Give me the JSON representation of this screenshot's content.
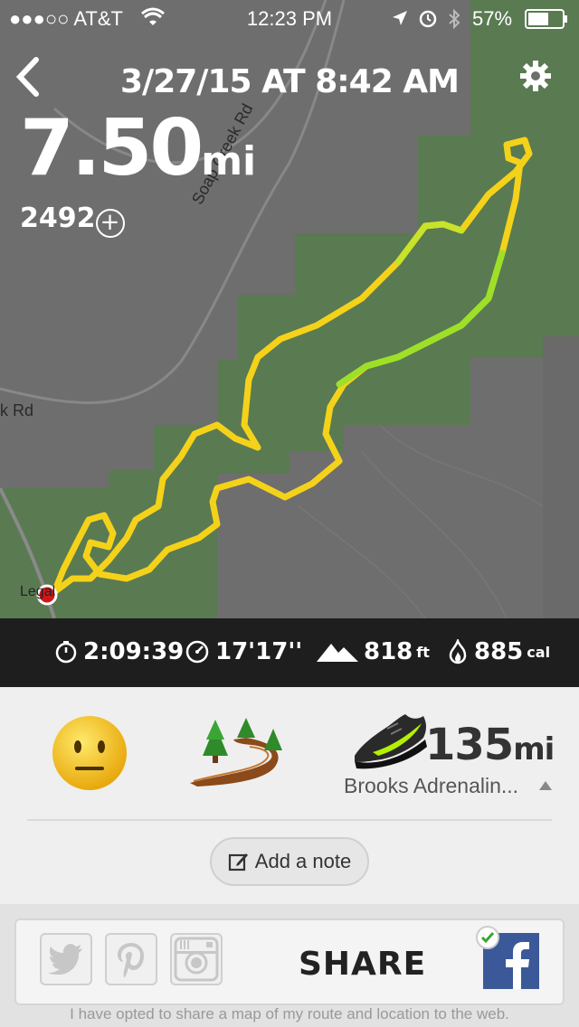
{
  "status_bar": {
    "carrier": "●●●○○ AT&T",
    "time": "12:23 PM",
    "battery": "57%"
  },
  "header": {
    "title": "3/27/15 AT 8:42 AM"
  },
  "run": {
    "distance_value": "7.50",
    "distance_unit": "mi",
    "fuel": "2492"
  },
  "map": {
    "road_labels": [
      "Soap Creek Rd",
      "k Rd"
    ],
    "legal": "Legal"
  },
  "stats": {
    "duration": "2:09:39",
    "pace": "17'17''",
    "elevation_value": "818",
    "elevation_unit": "ft",
    "calories_value": "885",
    "calories_unit": "cal"
  },
  "details": {
    "shoe_distance_value": "135",
    "shoe_distance_unit": "mi",
    "shoe_name": "Brooks Adrenalin...",
    "add_note_label": "Add a note"
  },
  "share": {
    "label": "SHARE",
    "disclaimer": "I have opted to share a map of my route and location to the web."
  },
  "icons": {
    "mood": "neutral-face-icon",
    "terrain": "trail-icon",
    "shoe": "shoe-icon"
  },
  "colors": {
    "map_green": "#5a7a52",
    "map_gray": "#6e6e6e",
    "route_yellow": "#f5d21a",
    "route_green": "#9ee028",
    "stats_bg": "#1e1e1e",
    "facebook": "#3b5998"
  }
}
